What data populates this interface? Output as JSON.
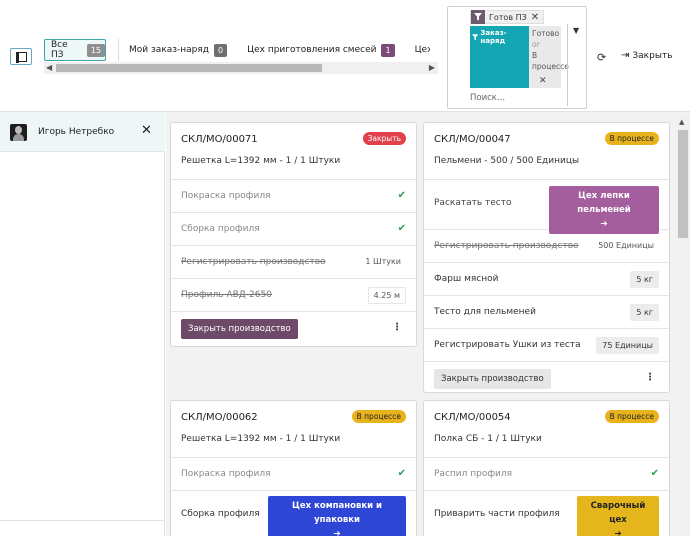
{
  "toolbar": {
    "tabs": [
      {
        "label": "Все ПЗ",
        "count": "15"
      },
      {
        "label": "Мой заказ-наряд",
        "count": "0"
      },
      {
        "label": "Цех приготовления смесей",
        "count": "1"
      },
      {
        "label": "Цех с"
      }
    ],
    "add_icon": "plus-icon",
    "close_label": "Закрыть"
  },
  "search": {
    "facet1": {
      "value": "Готов ПЗ"
    },
    "facet2": {
      "label": "Заказ-наряд",
      "value1": "Готово",
      "or": "or",
      "value2": "В процессе"
    },
    "placeholder": "Поиск..."
  },
  "user": {
    "name": "Игорь Нетребко"
  },
  "cards": [
    {
      "title": "СКЛ/MO/00071",
      "status": "Закрыть",
      "subtitle": "Решетка L=1392 мм - 1 / 1 Штуки",
      "rows": [
        {
          "label": "Покраска профиля"
        },
        {
          "label": "Сборка профиля"
        },
        {
          "label": "Регистрировать производство",
          "qty": "1 Штуки"
        },
        {
          "label": "Профиль АВД-2650",
          "qty": "4.25 м"
        }
      ],
      "footer_button": "Закрыть производство"
    },
    {
      "title": "СКЛ/MO/00047",
      "status": "В процессе",
      "subtitle": "Пельмени - 500 / 500 Единицы",
      "rows": [
        {
          "label": "Раскатать тесто",
          "workcenter": "Цех лепки пельменей",
          "arrow": "➔"
        },
        {
          "label": "Регистрировать производство",
          "qty": "500 Единицы"
        },
        {
          "label": "Фарш мясной",
          "qty": "5 кг"
        },
        {
          "label": "Тесто для пельменей",
          "qty": "5 кг"
        },
        {
          "label": "Регистрировать Ушки из теста",
          "qty": "75 Единицы"
        }
      ],
      "footer_button": "Закрыть производство"
    },
    {
      "title": "СКЛ/MO/00062",
      "status": "В процессе",
      "subtitle": "Решетка L=1392 мм - 1 / 1 Штуки",
      "rows": [
        {
          "label": "Покраска профиля"
        },
        {
          "label": "Сборка профиля",
          "workcenter": "Цех компановки и упаковки",
          "arrow": "➔"
        }
      ]
    },
    {
      "title": "СКЛ/MO/00054",
      "status": "В процессе",
      "subtitle": "Полка СБ - 1 / 1 Штуки",
      "rows": [
        {
          "label": "Распил профиля"
        },
        {
          "label": "Приварить части профиля",
          "workcenter": "Сварочный цех",
          "arrow": "➔"
        }
      ]
    }
  ],
  "colors": {
    "accent": "#14a6b3",
    "status_closed": "#e0414b",
    "status_progress": "#e8b21c",
    "btn_dark": "#6d4a68"
  }
}
